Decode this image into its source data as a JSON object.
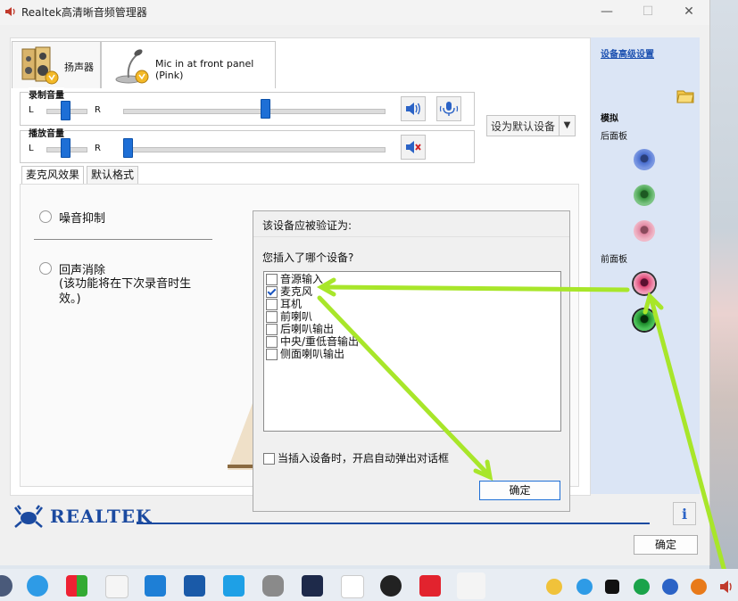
{
  "window": {
    "title": "Realtek高清晰音频管理器",
    "minimize": "—",
    "maximize": "☐",
    "close": "✕"
  },
  "tabs": {
    "speaker": "扬声器",
    "mic": "Mic in at front panel (Pink)"
  },
  "record": {
    "label": "录制音量",
    "left": "L",
    "right": "R",
    "balance_level": 0.5,
    "volume_level": 0.54
  },
  "playback": {
    "label": "播放音量",
    "left": "L",
    "right": "R",
    "balance_level": 0.5,
    "volume_level": 0.02
  },
  "default_device": "设为默认设备",
  "subtabs": [
    "麦克风效果",
    "默认格式"
  ],
  "effects": {
    "noise_suppression": "噪音抑制",
    "echo_cancel": "回声消除",
    "echo_note": "(该功能将在下次录音时生效。)"
  },
  "right_panel": {
    "link": "设备高级设置",
    "analog": "模拟",
    "back_panel": "后面板",
    "front_panel": "前面板",
    "colors": {
      "back1": "#4a6fd0",
      "back2": "#3e9a45",
      "back3": "#e28aa4",
      "front1": "#e04a78",
      "front2": "#1c8a2a"
    }
  },
  "dialog": {
    "title": "该设备应被验证为:",
    "question": "您插入了哪个设备?",
    "options": [
      {
        "label": "音源输入",
        "checked": false
      },
      {
        "label": "麦克风",
        "checked": true
      },
      {
        "label": "耳机",
        "checked": false
      },
      {
        "label": "前喇叭",
        "checked": false
      },
      {
        "label": "后喇叭输出",
        "checked": false
      },
      {
        "label": "中央/重低音输出",
        "checked": false
      },
      {
        "label": "侧面喇叭输出",
        "checked": false
      }
    ],
    "auto_popup": "当插入设备时，开启自动弹出对话框",
    "ok": "确定"
  },
  "brand": "REALTEK",
  "footer_ok": "确定",
  "info_icon": "i"
}
